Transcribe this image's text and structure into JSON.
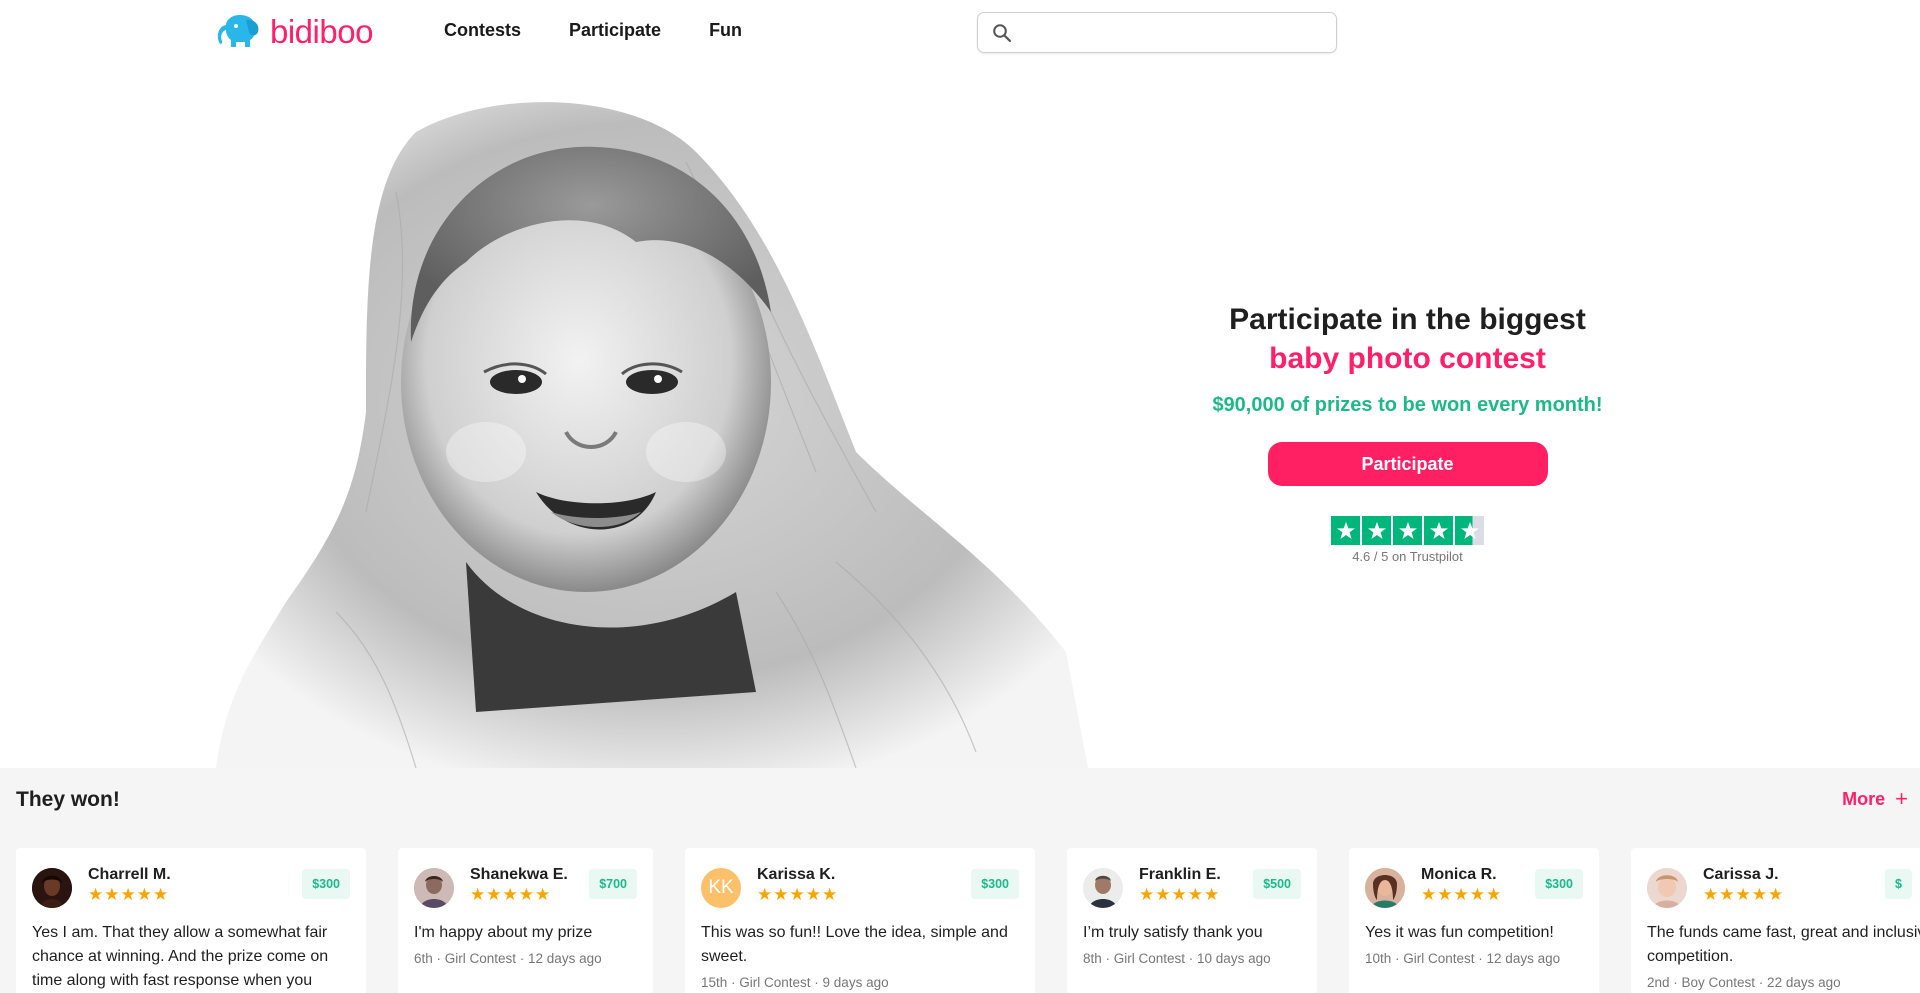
{
  "header": {
    "logo_text": "bidiboo",
    "nav": [
      "Contests",
      "Participate",
      "Fun"
    ],
    "search_placeholder": ""
  },
  "hero": {
    "title_line1": "Participate in the biggest",
    "title_line2": "baby photo contest",
    "prize_text": "$90,000 of prizes to be won every month!",
    "cta_label": "Participate",
    "trustpilot_caption": "4.6 / 5 on Trustpilot",
    "trustpilot_rating": 4.6
  },
  "winners": {
    "title": "They won!",
    "more_label": "More",
    "cards": [
      {
        "name": "Charrell M.",
        "prize": "$300",
        "stars": 5,
        "review": "Yes I am. That they allow a somewhat fair chance at winning. And the prize come on time along with fast response when you",
        "meta": "",
        "avatar": "photo"
      },
      {
        "name": "Shanekwa E.",
        "prize": "$700",
        "stars": 5,
        "review": "I'm happy about my prize",
        "meta": "6th · Girl Contest · 12 days ago",
        "avatar": "photo"
      },
      {
        "name": "Karissa K.",
        "prize": "$300",
        "stars": 5,
        "review": "This was so fun!! Love the idea, simple and sweet.",
        "meta": "15th · Girl Contest · 9 days ago",
        "avatar": "KK"
      },
      {
        "name": "Franklin E.",
        "prize": "$500",
        "stars": 5,
        "review": "I’m truly satisfy thank you",
        "meta": "8th · Girl Contest · 10 days ago",
        "avatar": "photo"
      },
      {
        "name": "Monica R.",
        "prize": "$300",
        "stars": 5,
        "review": "Yes it was fun competition!",
        "meta": "10th · Girl Contest · 12 days ago",
        "avatar": "photo"
      },
      {
        "name": "Carissa J.",
        "prize": "$",
        "stars": 5,
        "review": "The funds came fast, great and inclusive competition.",
        "meta": "2nd · Boy Contest · 22 days ago",
        "avatar": "photo"
      }
    ]
  },
  "colors": {
    "brand_pink": "#ff1f6a",
    "brand_blue": "#29b6e8",
    "prize_green": "#1db98a",
    "trustpilot_green": "#00b67a",
    "star_gold": "#f7a600"
  },
  "icons": [
    "elephant-logo-icon",
    "search-icon",
    "trustpilot-star-icon",
    "plus-icon",
    "rating-star-icon"
  ]
}
